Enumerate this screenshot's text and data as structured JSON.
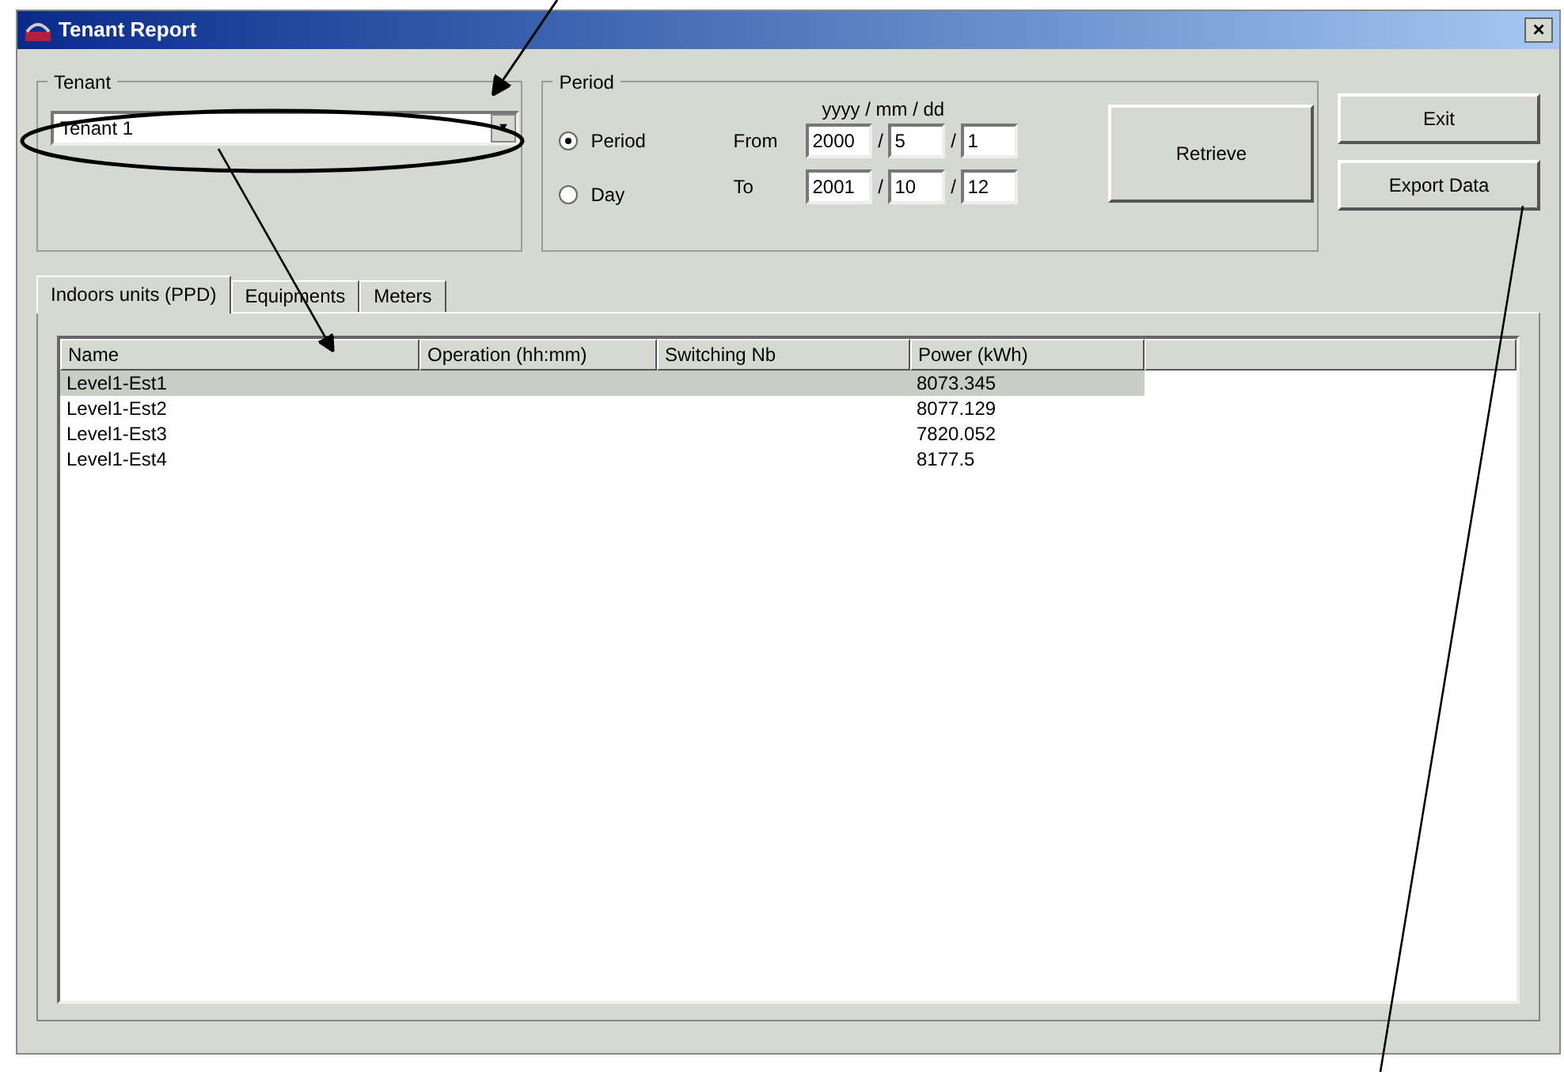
{
  "window": {
    "title": "Tenant Report",
    "close": "×"
  },
  "tenant_group": {
    "label": "Tenant",
    "combo": {
      "value": "Tenant 1",
      "arrow": "▼"
    }
  },
  "period_group": {
    "label": "Period",
    "options": [
      {
        "label": "Period",
        "selected": true
      },
      {
        "label": "Day",
        "selected": false
      }
    ],
    "date_header": "yyyy / mm / dd",
    "rows": [
      {
        "label": "From",
        "fields": [
          "2000",
          "5",
          "1"
        ]
      },
      {
        "label": "To",
        "fields": [
          "2001",
          "10",
          "12"
        ]
      }
    ],
    "separator": "/",
    "retrieve_button": "Retrieve"
  },
  "buttons": [
    "Exit",
    "Export Data"
  ],
  "tabs": [
    {
      "label": "Indoors units (PPD)",
      "selected": true
    },
    {
      "label": "Equipments",
      "selected": false
    },
    {
      "label": "Meters",
      "selected": false
    }
  ],
  "table": {
    "columns": [
      "Name",
      "Operation (hh:mm)",
      "Switching Nb",
      "Power (kWh)"
    ],
    "rows": [
      {
        "cells": [
          "Level1-Est1",
          "",
          "",
          "8073.345"
        ],
        "selected": true
      },
      {
        "cells": [
          "Level1-Est2",
          "",
          "",
          "8077.129"
        ],
        "selected": false
      },
      {
        "cells": [
          "Level1-Est3",
          "",
          "",
          "7820.052"
        ],
        "selected": false
      },
      {
        "cells": [
          "Level1-Est4",
          "",
          "",
          "8177.5"
        ],
        "selected": false
      }
    ]
  }
}
